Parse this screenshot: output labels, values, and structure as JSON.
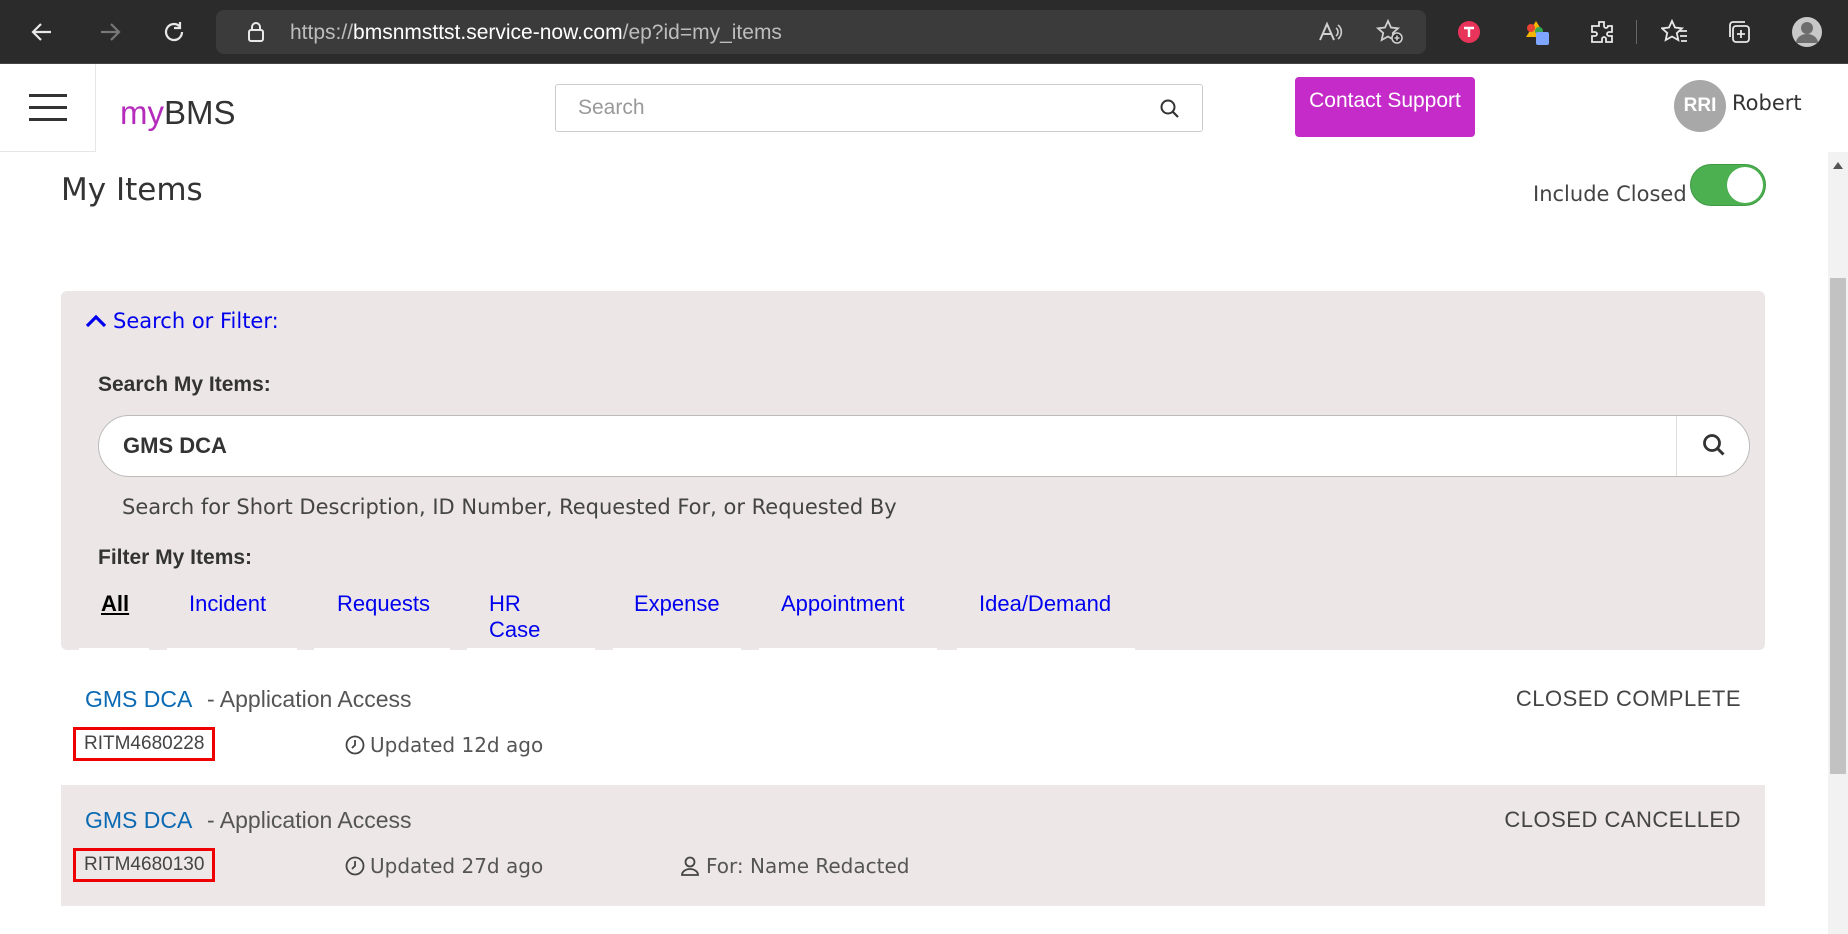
{
  "browser": {
    "url_prefix": "https://",
    "url_host": "bmsnmsttst.service-now.com",
    "url_path": "/ep?id=my_items"
  },
  "header": {
    "logo_my": "my",
    "logo_bms": "BMS",
    "search_placeholder": "Search",
    "contact_label": "Contact Support",
    "avatar_initials": "RRI",
    "user_name": "Robert"
  },
  "page": {
    "title": "My Items",
    "include_closed_label": "Include Closed",
    "include_closed_on": true
  },
  "filter_panel": {
    "toggle_label": "Search or Filter:",
    "search_label": "Search My Items:",
    "search_value": "GMS DCA",
    "hint": "Search for Short Description, ID Number, Requested For, or Requested By",
    "filter_label": "Filter My Items:",
    "tabs": [
      "All",
      "Incident",
      "Requests",
      "HR Case",
      "Expense",
      "Appointment",
      "Idea/Demand"
    ]
  },
  "items": [
    {
      "title": "GMS DCA",
      "desc": "- Application Access",
      "status": "CLOSED COMPLETE",
      "number": "RITM4680228",
      "updated": "Updated 12d ago",
      "for": ""
    },
    {
      "title": "GMS DCA",
      "desc": "- Application Access",
      "status": "CLOSED CANCELLED",
      "number": "RITM4680130",
      "updated": "Updated 27d ago",
      "for": "For: Name Redacted"
    }
  ],
  "colors": {
    "brand": "#b52bbc",
    "contact_button": "#c52bc9",
    "toggle_on": "#4caf50",
    "link": "#0b6ab3",
    "highlight_box": "#ee0000"
  }
}
